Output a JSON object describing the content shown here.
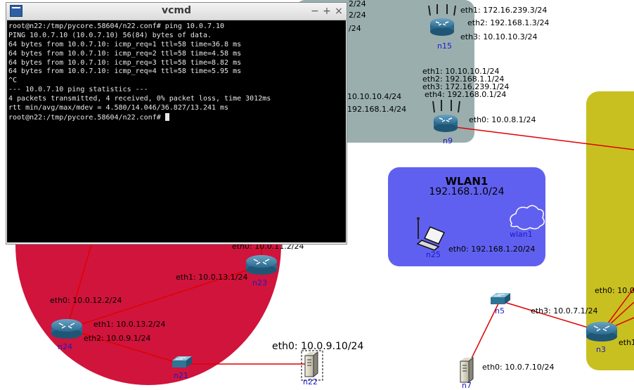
{
  "terminal": {
    "title": "vcmd",
    "buttons": {
      "minimize": "−",
      "maximize": "+",
      "close": "×"
    },
    "lines": [
      "root@n22:/tmp/pycore.58604/n22.conf# ping 10.0.7.10",
      "PING 10.0.7.10 (10.0.7.10) 56(84) bytes of data.",
      "64 bytes from 10.0.7.10: icmp_req=1 ttl=58 time=36.8 ms",
      "64 bytes from 10.0.7.10: icmp_req=2 ttl=58 time=4.58 ms",
      "64 bytes from 10.0.7.10: icmp_req=3 ttl=58 time=8.82 ms",
      "64 bytes from 10.0.7.10: icmp_req=4 ttl=58 time=5.95 ms",
      "^C",
      "--- 10.0.7.10 ping statistics ---",
      "4 packets transmitted, 4 received, 0% packet loss, time 3012ms",
      "rtt min/avg/max/mdev = 4.580/14.046/36.827/13.241 ms",
      "root@n22:/tmp/pycore.58604/n22.conf# "
    ]
  },
  "wlan": {
    "title": "WLAN1",
    "subnet": "192.168.1.0/24",
    "cloud_label": "wlan1"
  },
  "nodes": {
    "n15": {
      "name": "n15",
      "eth1": "eth1: 172.16.239.3/24",
      "eth2": "eth2: 192.168.1.3/24",
      "eth3": "eth3: 10.10.10.3/24",
      "top_partial": "eth1: 172.16.239.3/24"
    },
    "n9": {
      "name": "n9",
      "eth1": "eth1: 10.10.10.1/24",
      "eth2": "eth2: 192.168.1.1/24",
      "eth3": "eth3: 172.16.239.1/24",
      "eth4": "eth4: 192.168.0.1/24",
      "eth0": "eth0: 10.0.8.1/24"
    },
    "hidden": {
      "a": "2/24",
      "b": "2/24",
      "c": "/24",
      "d": "10.10.10.4/24",
      "e": "192.168.1.4/24"
    },
    "n25": {
      "name": "n25",
      "eth0": "eth0: 192.168.1.20/24"
    },
    "n23": {
      "name": "n23",
      "eth0": "eth0: 10.0.11.2/24",
      "eth1": "eth1: 10.0.13.1/24"
    },
    "n24": {
      "name": "n24",
      "eth0": "eth0: 10.0.12.2/24",
      "eth1": "eth1: 10.0.13.2/24",
      "eth2": "eth2: 10.0.9.1/24"
    },
    "n21": {
      "name": "n21"
    },
    "n22": {
      "name": "n22",
      "eth0": "eth0: 10.0.9.10/24"
    },
    "n5": {
      "name": "n5",
      "eth3": "eth3: 10.0.7.1/24"
    },
    "n7": {
      "name": "n7",
      "eth0": "eth0: 10.0.7.10/24"
    },
    "n3": {
      "name": "n3",
      "eth0": "eth0: 10.0",
      "eth1": "eth1"
    }
  },
  "colors": {
    "terminal_bg": "#000000",
    "gray_region": "#9aaeae",
    "red_region": "#d0143c",
    "wlan_region": "#6060f0",
    "olive_region": "#c8c020",
    "link": "#e00000",
    "node_label": "#1a1acc"
  }
}
